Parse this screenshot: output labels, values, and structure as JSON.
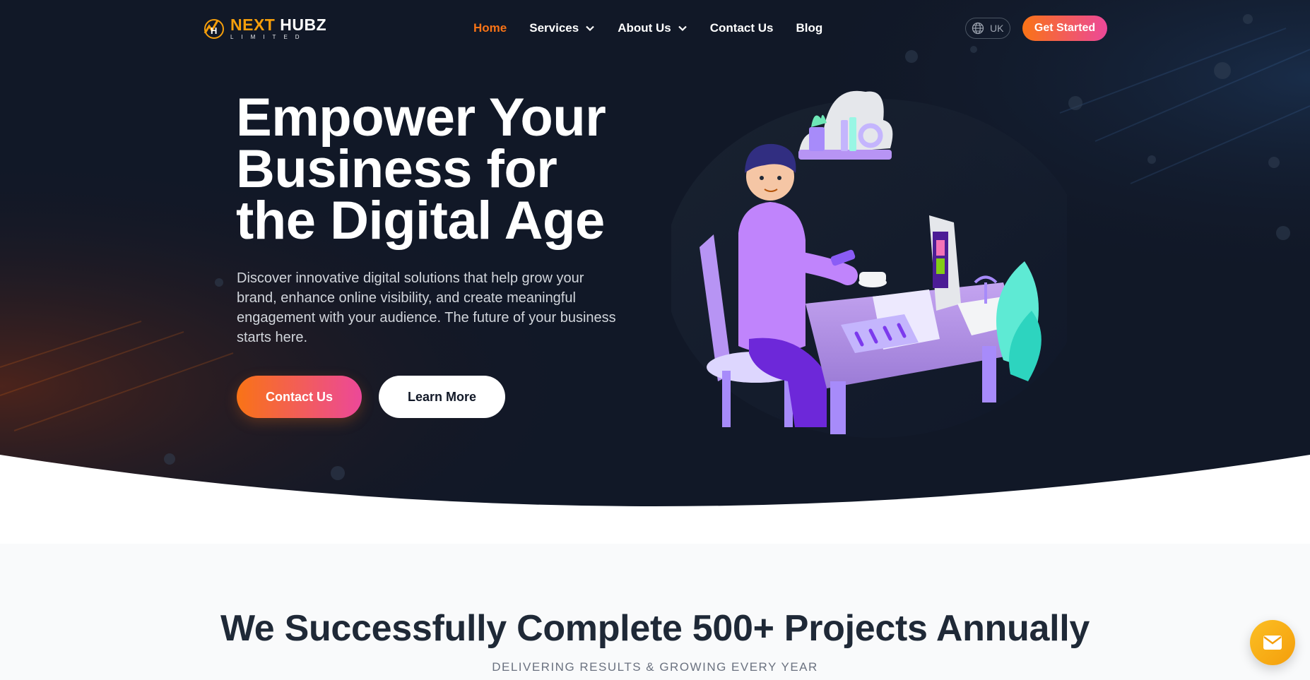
{
  "brand": {
    "name_part1": "NEXT",
    "name_part2": "HUBZ",
    "tagline": "LIMITED"
  },
  "nav": {
    "items": [
      {
        "label": "Home",
        "active": true
      },
      {
        "label": "Services",
        "dropdown": true
      },
      {
        "label": "About Us",
        "dropdown": true
      },
      {
        "label": "Contact Us"
      },
      {
        "label": "Blog"
      }
    ],
    "language": "UK",
    "cta": "Get Started"
  },
  "hero": {
    "headline_line1": "Empower Your",
    "headline_line2": "Business for",
    "headline_line3": "the Digital Age",
    "lead": "Discover innovative digital solutions that help grow your brand, enhance online visibility, and create meaningful engagement with your audience. The future of your business starts here.",
    "primary_button": "Contact Us",
    "secondary_button": "Learn More"
  },
  "stats": {
    "title": "We Successfully Complete 500+ Projects Annually",
    "subtitle": "DELIVERING RESULTS & GROWING EVERY YEAR"
  },
  "colors": {
    "accent_orange": "#f97316",
    "accent_pink": "#ec4899",
    "hero_bg": "#111827",
    "brand_gold": "#f59e0b"
  },
  "icons": [
    "logo-icon",
    "chevron-down-icon",
    "globe-icon",
    "mail-icon"
  ]
}
